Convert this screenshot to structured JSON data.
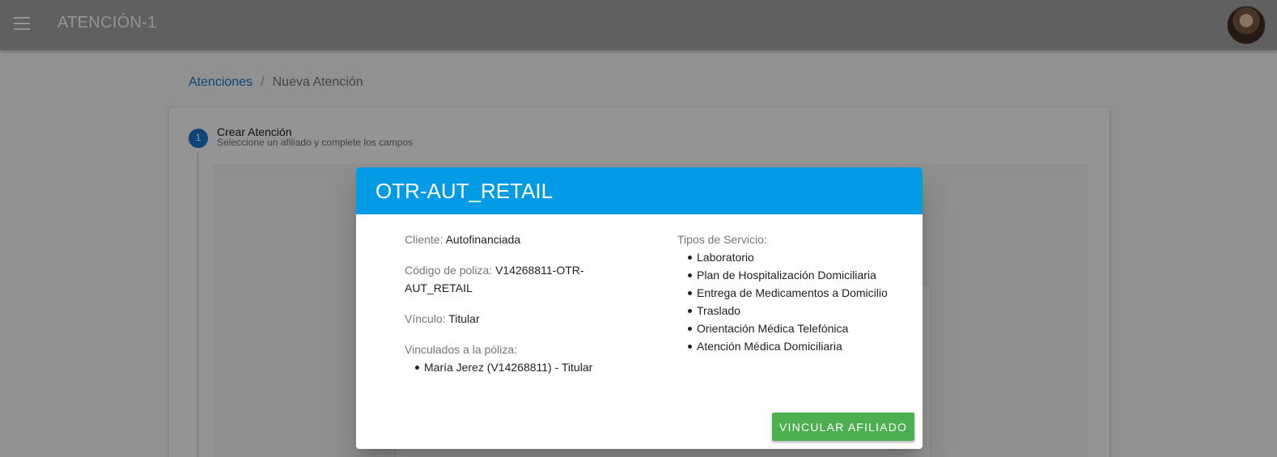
{
  "app": {
    "title": "ATENCIÓN-1"
  },
  "breadcrumb": {
    "link": "Atenciones",
    "separator": "/",
    "current": "Nueva Atención"
  },
  "stepper": {
    "number": "1",
    "title": "Crear Atención",
    "subtitle": "Seleccione un afiliado y complete los campos"
  },
  "dialog": {
    "title": "OTR-AUT_RETAIL",
    "cliente_label": "Cliente:",
    "cliente_value": "Autofinanciada",
    "codigo_label": "Código de poliza:",
    "codigo_value": "V14268811-OTR-AUT_RETAIL",
    "vinculo_label": "Vínculo:",
    "vinculo_value": "Titular",
    "vinculados_label": "Vinculados a la póliza:",
    "vinculados": [
      "María Jerez (V14268811) - Titular"
    ],
    "servicios_label": "Tipos de Servicio:",
    "servicios": [
      "Laboratorio",
      "Plan de Hospitalización Domiciliaria",
      "Entrega de Medicamentos a Domicilio",
      "Traslado",
      "Orientación Médica Telefónica",
      "Atención Médica Domiciliaria"
    ],
    "button_label": "VINCULAR AFILIADO"
  },
  "colors": {
    "header": "#039be5",
    "button": "#4caf50",
    "link": "#1976d2"
  }
}
